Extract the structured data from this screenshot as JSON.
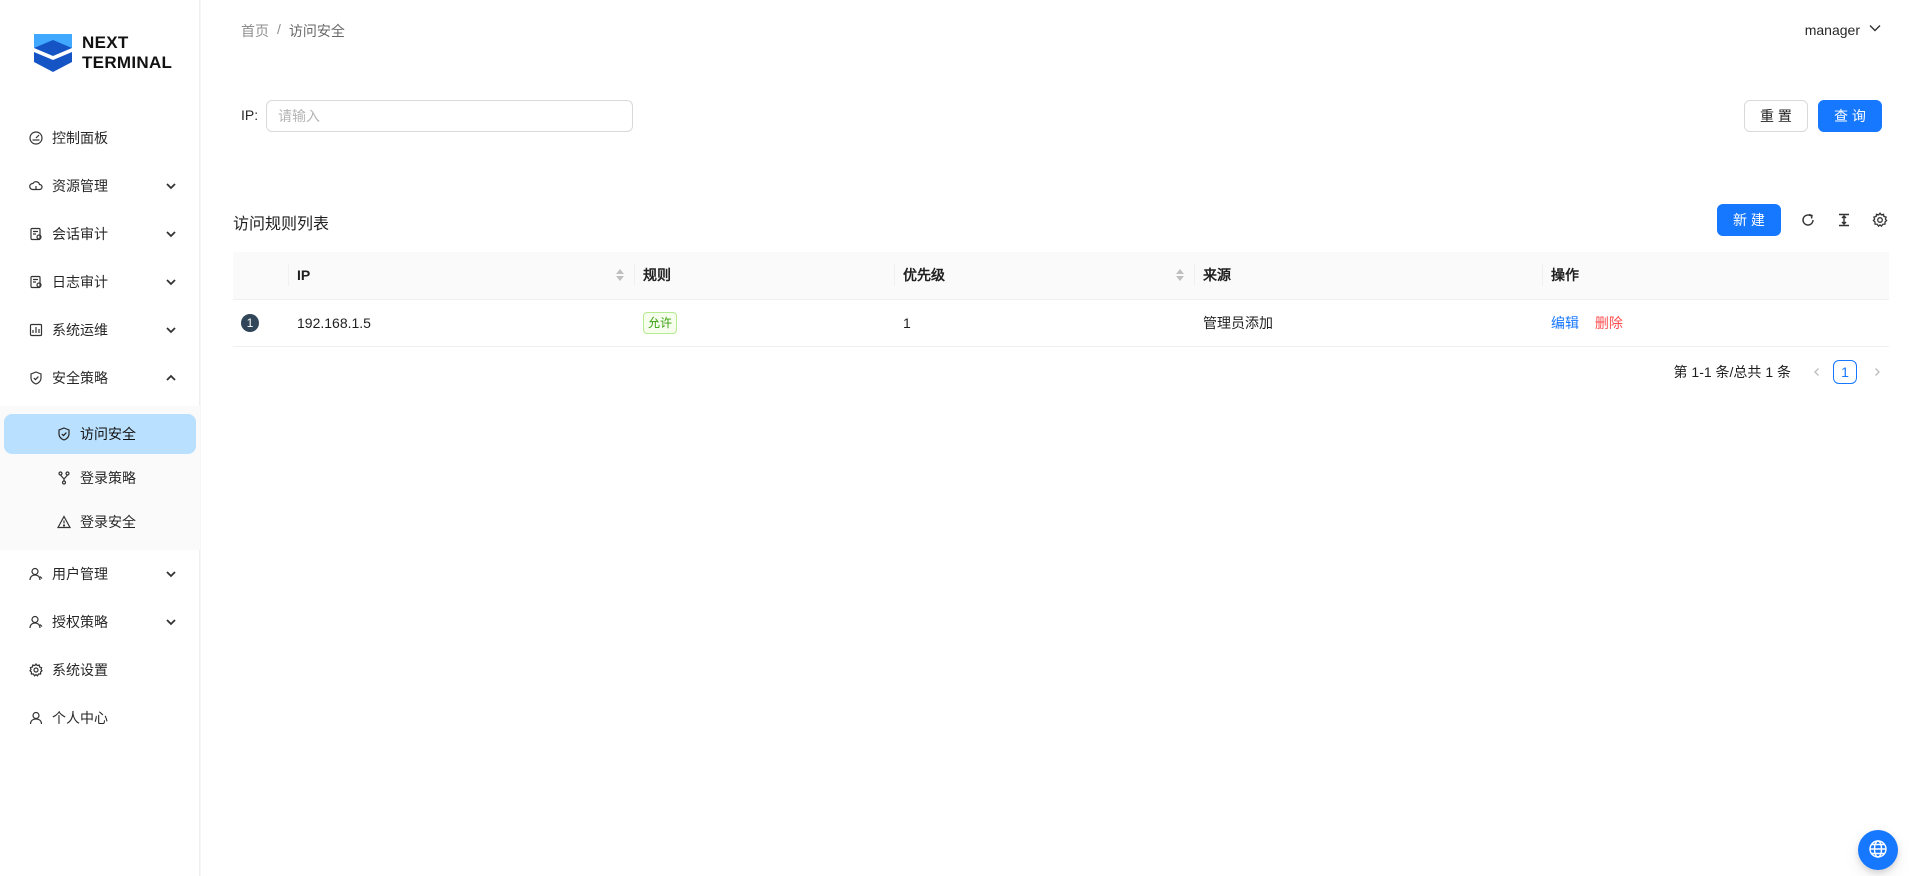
{
  "brand": {
    "line1": "NEXT",
    "line2": "TERMINAL",
    "color": "#1677ff"
  },
  "sidebar": {
    "items": [
      {
        "label": "控制面板",
        "icon": "dashboard-icon"
      },
      {
        "label": "资源管理",
        "icon": "cloud-icon"
      },
      {
        "label": "会话审计",
        "icon": "audit-icon"
      },
      {
        "label": "日志审计",
        "icon": "audit-icon"
      },
      {
        "label": "系统运维",
        "icon": "ops-icon"
      },
      {
        "label": "安全策略",
        "icon": "shield-icon"
      },
      {
        "label": "用户管理",
        "icon": "user-icon"
      },
      {
        "label": "授权策略",
        "icon": "user-icon"
      },
      {
        "label": "系统设置",
        "icon": "gear-icon"
      },
      {
        "label": "个人中心",
        "icon": "user-icon"
      }
    ],
    "security_sub": [
      {
        "label": "访问安全",
        "icon": "shield-check-icon",
        "active": true
      },
      {
        "label": "登录策略",
        "icon": "fork-icon"
      },
      {
        "label": "登录安全",
        "icon": "warning-icon"
      }
    ]
  },
  "header": {
    "breadcrumb": [
      "首页",
      "访问安全"
    ],
    "breadcrumb_sep": "/",
    "user": "manager"
  },
  "search": {
    "label": "IP:",
    "placeholder": "请输入",
    "reset_label": "重 置",
    "query_label": "查 询"
  },
  "table": {
    "title": "访问规则列表",
    "new_label": "新 建",
    "columns": [
      "IP",
      "规则",
      "优先级",
      "来源",
      "操作"
    ],
    "rows": [
      {
        "index": "1",
        "ip": "192.168.1.5",
        "rule": "允许",
        "priority": "1",
        "source": "管理员添加",
        "edit": "编辑",
        "delete": "删除"
      }
    ]
  },
  "pagination": {
    "summary": "第 1-1 条/总共 1 条",
    "current": "1"
  }
}
